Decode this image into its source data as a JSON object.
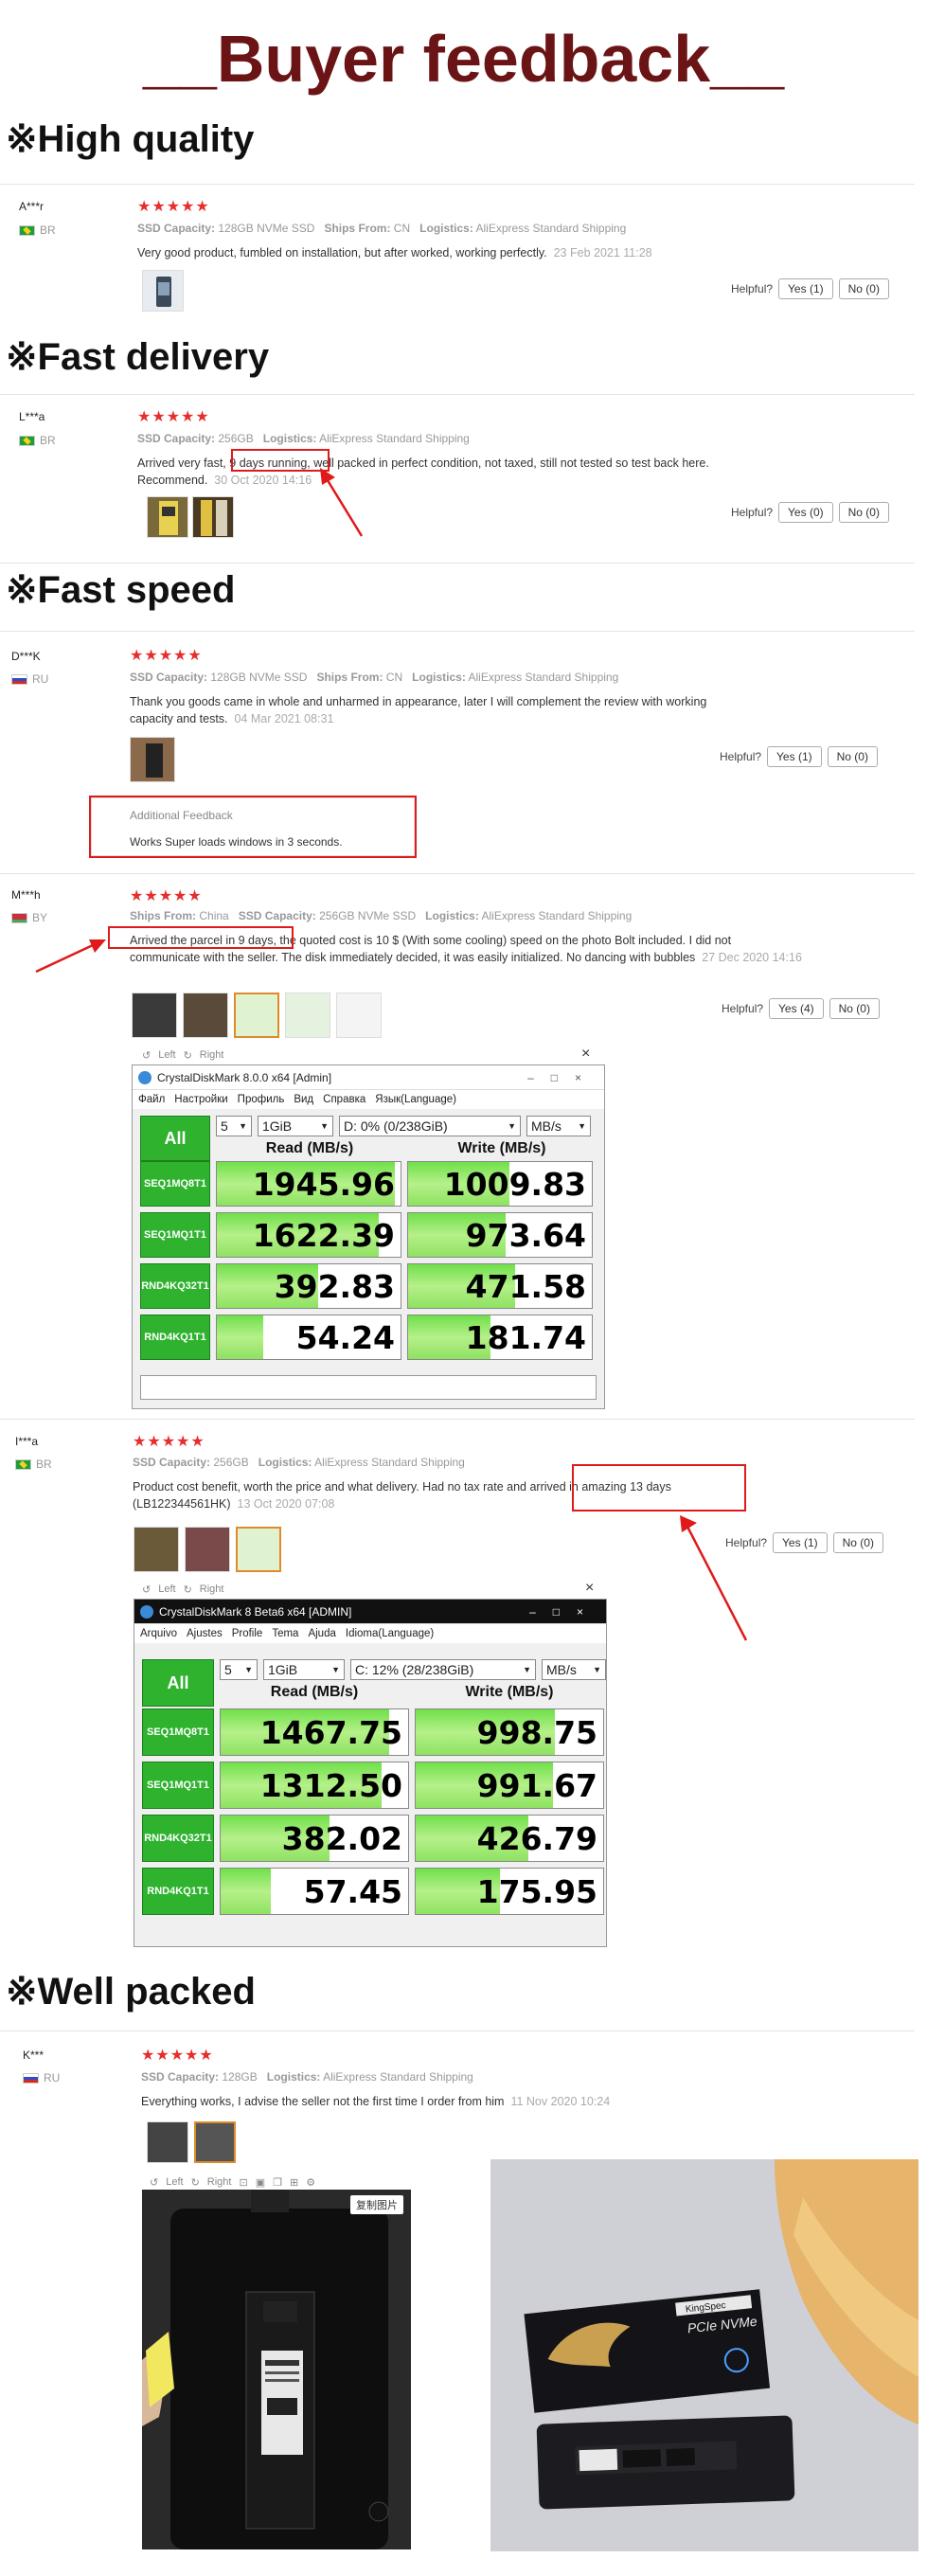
{
  "title": "__Buyer feedback__",
  "sections": {
    "s1": "※High quality",
    "s2": "※Fast delivery",
    "s3": "※Fast speed",
    "s4": "※Well packed"
  },
  "stars": "★★★★★",
  "helpful": "Helpful?",
  "reviews": {
    "r1": {
      "user": "A***r",
      "country": "BR",
      "meta1": "SSD Capacity:",
      "meta1v": "128GB NVMe SSD",
      "meta2": "Ships From:",
      "meta2v": "CN",
      "meta3": "Logistics:",
      "meta3v": "AliExpress Standard Shipping",
      "text": "Very good product, fumbled on installation, but after worked, working perfectly.",
      "date": "23 Feb 2021 11:28",
      "yes": "Yes (1)",
      "no": "No (0)"
    },
    "r2": {
      "user": "L***a",
      "country": "BR",
      "meta1": "SSD Capacity:",
      "meta1v": "256GB",
      "meta2": "Logistics:",
      "meta2v": "AliExpress Standard Shipping",
      "text1": "Arrived very fast,",
      "hl": "9 days running,",
      "text2": " well packed in perfect condition, not taxed, still not tested so test back here.",
      "text3": "Recommend.",
      "date": "30 Oct 2020 14:16",
      "yes": "Yes (0)",
      "no": "No (0)"
    },
    "r3": {
      "user": "D***K",
      "country": "RU",
      "meta1": "SSD Capacity:",
      "meta1v": "128GB NVMe SSD",
      "meta2": "Ships From:",
      "meta2v": "CN",
      "meta3": "Logistics:",
      "meta3v": "AliExpress Standard Shipping",
      "text1": "Thank you goods came in whole and unharmed in appearance, later I will complement the review with working",
      "text2": "capacity and tests.",
      "date": "04 Mar 2021 08:31",
      "yes": "Yes (1)",
      "no": "No (0)",
      "add_title": "Additional Feedback",
      "add_text": "Works Super loads windows in 3 seconds."
    },
    "r4": {
      "user": "M***h",
      "country": "BY",
      "meta1": "Ships From:",
      "meta1v": "China",
      "meta2": "SSD Capacity:",
      "meta2v": "256GB NVMe SSD",
      "meta3": "Logistics:",
      "meta3v": "AliExpress Standard Shipping",
      "hl": "Arrived the parcel in 9 days",
      "text1": ", the quoted cost is 10 $ (With some cooling) speed on the photo Bolt included. I did not",
      "text2": "communicate with the seller. The disk immediately decided, it was easily initialized. No dancing with bubbles",
      "date": "27 Dec 2020 14:16",
      "yes": "Yes (4)",
      "no": "No (0)"
    },
    "r5": {
      "user": "I***a",
      "country": "BR",
      "meta1": "SSD Capacity:",
      "meta1v": "256GB",
      "meta2": "Logistics:",
      "meta2v": "AliExpress Standard Shipping",
      "text1": "Product cost benefit, worth the price and what delivery. Had no tax rate and",
      "hl": "arrived in amazing 13 days",
      "text2": "(LB122344561HK)",
      "date": "13 Oct 2020 07:08",
      "yes": "Yes (1)",
      "no": "No (0)"
    },
    "r6": {
      "user": "K***",
      "country": "RU",
      "meta1": "SSD Capacity:",
      "meta1v": "128GB",
      "meta2": "Logistics:",
      "meta2v": "AliExpress Standard Shipping",
      "text": "Everything works, I advise the seller not the first time I order from him",
      "date": "11 Nov 2020 10:24",
      "copy": "复制图片"
    }
  },
  "viewer": {
    "left": "Left",
    "right": "Right",
    "close": "×"
  },
  "cdm1": {
    "title": "CrystalDiskMark 8.0.0 x64 [Admin]",
    "menu": [
      "Файл",
      "Настройки",
      "Профиль",
      "Вид",
      "Справка",
      "Язык(Language)"
    ],
    "all": "All",
    "count": "5",
    "size": "1GiB",
    "drive": "D: 0% (0/238GiB)",
    "unit": "MB/s",
    "read_hdr": "Read (MB/s)",
    "write_hdr": "Write (MB/s)",
    "rows": [
      {
        "l1": "SEQ1M",
        "l2": "Q8T1",
        "read": "1945.96",
        "write": "1009.83",
        "rf": 0.97,
        "wf": 0.55
      },
      {
        "l1": "SEQ1M",
        "l2": "Q1T1",
        "read": "1622.39",
        "write": "973.64",
        "rf": 0.88,
        "wf": 0.53
      },
      {
        "l1": "RND4K",
        "l2": "Q32T1",
        "read": "392.83",
        "write": "471.58",
        "rf": 0.55,
        "wf": 0.58
      },
      {
        "l1": "RND4K",
        "l2": "Q1T1",
        "read": "54.24",
        "write": "181.74",
        "rf": 0.25,
        "wf": 0.45
      }
    ]
  },
  "cdm2": {
    "title": "CrystalDiskMark 8 Beta6 x64 [ADMIN]",
    "menu": [
      "Arquivo",
      "Ajustes",
      "Profile",
      "Tema",
      "Ajuda",
      "Idioma(Language)"
    ],
    "all": "All",
    "count": "5",
    "size": "1GiB",
    "drive": "C: 12% (28/238GiB)",
    "unit": "MB/s",
    "read_hdr": "Read (MB/s)",
    "write_hdr": "Write (MB/s)",
    "rows": [
      {
        "l1": "SEQ1M",
        "l2": "Q8T1",
        "read": "1467.75",
        "write": "998.75",
        "rf": 0.9,
        "wf": 0.74
      },
      {
        "l1": "SEQ1M",
        "l2": "Q1T1",
        "read": "1312.50",
        "write": "991.67",
        "rf": 0.86,
        "wf": 0.73
      },
      {
        "l1": "RND4K",
        "l2": "Q32T1",
        "read": "382.02",
        "write": "426.79",
        "rf": 0.58,
        "wf": 0.6
      },
      {
        "l1": "RND4K",
        "l2": "Q1T1",
        "read": "57.45",
        "write": "175.95",
        "rf": 0.27,
        "wf": 0.45
      }
    ]
  },
  "product_box": {
    "brand": "KingSpec",
    "label": "PCIe NVMe"
  },
  "colors": {
    "title": "#6b1416",
    "star": "#e62e2e",
    "highlight": "#e01a1a",
    "bench_green": "#2fb32f"
  }
}
